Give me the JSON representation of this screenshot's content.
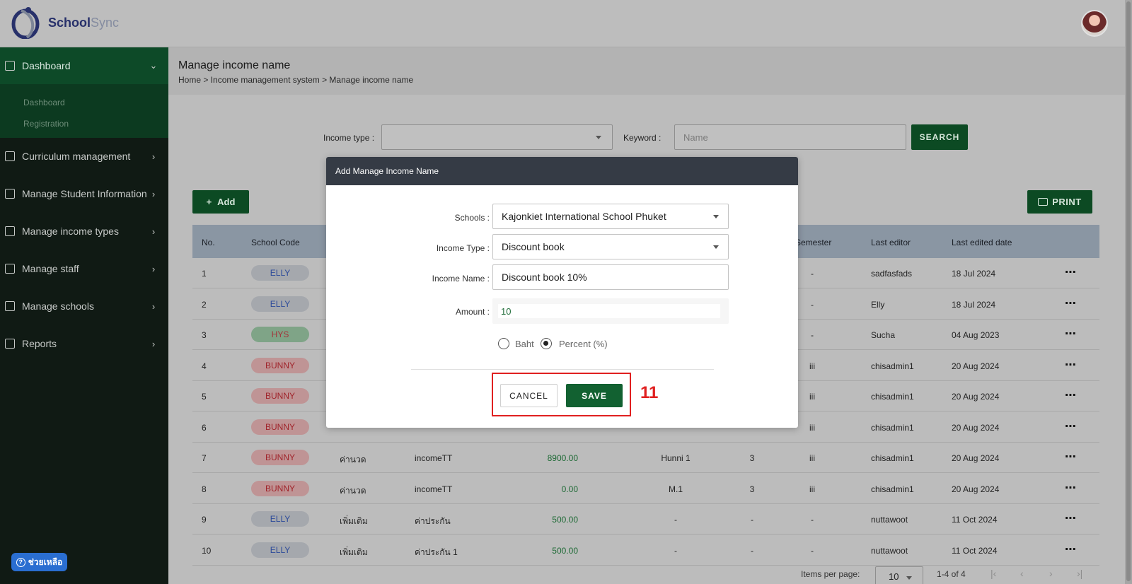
{
  "brand": {
    "part1": "School",
    "part2": "Sync"
  },
  "sidebar": {
    "items": [
      {
        "label": "Dashboard",
        "icon": "grid-icon"
      },
      {
        "label": "Curriculum management",
        "icon": "graduation-cap-icon"
      },
      {
        "label": "Manage Student Information",
        "icon": "student-icon"
      },
      {
        "label": "Manage income types",
        "icon": "flask-icon"
      },
      {
        "label": "Manage staff",
        "icon": "staff-icon"
      },
      {
        "label": "Manage schools",
        "icon": "school-icon"
      },
      {
        "label": "Reports",
        "icon": "clipboard-icon"
      }
    ],
    "subitems": [
      "Dashboard",
      "Registration"
    ],
    "help_label": "ช่วยเหลือ"
  },
  "page": {
    "title": "Manage income name",
    "breadcrumb": "Home > Income management system > Manage income name"
  },
  "filters": {
    "income_type_label": "Income type :",
    "keyword_label": "Keyword :",
    "keyword_placeholder": "Name",
    "search_label": "SEARCH"
  },
  "toolbar": {
    "add_label": "Add",
    "print_label": "PRINT"
  },
  "table": {
    "headers": {
      "no": "No.",
      "school_code": "School Code",
      "semester": "Semester",
      "last_editor": "Last editor",
      "last_edited_date": "Last edited date"
    },
    "rows": [
      {
        "no": "1",
        "code": "ELLY",
        "type": "",
        "name": "",
        "amount": "",
        "level": "",
        "year": "",
        "semester": "-",
        "editor": "sadfasfads",
        "date": "18 Jul 2024"
      },
      {
        "no": "2",
        "code": "ELLY",
        "type": "",
        "name": "",
        "amount": "",
        "level": "",
        "year": "",
        "semester": "-",
        "editor": "Elly",
        "date": "18 Jul 2024"
      },
      {
        "no": "3",
        "code": "HYS",
        "type": "",
        "name": "",
        "amount": "",
        "level": "",
        "year": "",
        "semester": "-",
        "editor": "Sucha",
        "date": "04 Aug 2023"
      },
      {
        "no": "4",
        "code": "BUNNY",
        "type": "",
        "name": "",
        "amount": "",
        "level": "",
        "year": "",
        "semester": "iii",
        "editor": "chisadmin1",
        "date": "20 Aug 2024"
      },
      {
        "no": "5",
        "code": "BUNNY",
        "type": "",
        "name": "",
        "amount": "",
        "level": "",
        "year": "",
        "semester": "iii",
        "editor": "chisadmin1",
        "date": "20 Aug 2024"
      },
      {
        "no": "6",
        "code": "BUNNY",
        "type": "",
        "name": "",
        "amount": "",
        "level": "",
        "year": "",
        "semester": "iii",
        "editor": "chisadmin1",
        "date": "20 Aug 2024"
      },
      {
        "no": "7",
        "code": "BUNNY",
        "type": "ค่านวด",
        "name": "incomeTT",
        "amount": "8900.00",
        "level": "Hunni 1",
        "year": "3",
        "semester": "iii",
        "editor": "chisadmin1",
        "date": "20 Aug 2024"
      },
      {
        "no": "8",
        "code": "BUNNY",
        "type": "ค่านวด",
        "name": "incomeTT",
        "amount": "0.00",
        "level": "M.1",
        "year": "3",
        "semester": "iii",
        "editor": "chisadmin1",
        "date": "20 Aug 2024"
      },
      {
        "no": "9",
        "code": "ELLY",
        "type": "เพิ่มเติม",
        "name": "ค่าประกัน",
        "amount": "500.00",
        "level": "-",
        "year": "-",
        "semester": "-",
        "editor": "nuttawoot",
        "date": "11 Oct 2024"
      },
      {
        "no": "10",
        "code": "ELLY",
        "type": "เพิ่มเติม",
        "name": "ค่าประกัน 1",
        "amount": "500.00",
        "level": "-",
        "year": "-",
        "semester": "-",
        "editor": "nuttawoot",
        "date": "11 Oct 2024"
      }
    ]
  },
  "pagination": {
    "items_per_page_label": "Items per page:",
    "per_page": "10",
    "range": "1-4 of 4"
  },
  "modal": {
    "title": "Add Manage Income Name",
    "schools_label": "Schools :",
    "schools_value": "Kajonkiet International School Phuket",
    "income_type_label": "Income Type :",
    "income_type_value": "Discount book",
    "income_name_label": "Income Name :",
    "income_name_value": "Discount book 10%",
    "amount_label": "Amount :",
    "amount_value": "10",
    "unit_options": [
      "Baht",
      "Percent (%)"
    ],
    "unit_selected": "Percent (%)",
    "cancel_label": "CANCEL",
    "save_label": "SAVE",
    "step_number": "11"
  },
  "colors": {
    "primary_green": "#126131",
    "sidebar_bg": "#101a14",
    "highlight_red": "#e02020",
    "modal_header": "#353b45"
  }
}
